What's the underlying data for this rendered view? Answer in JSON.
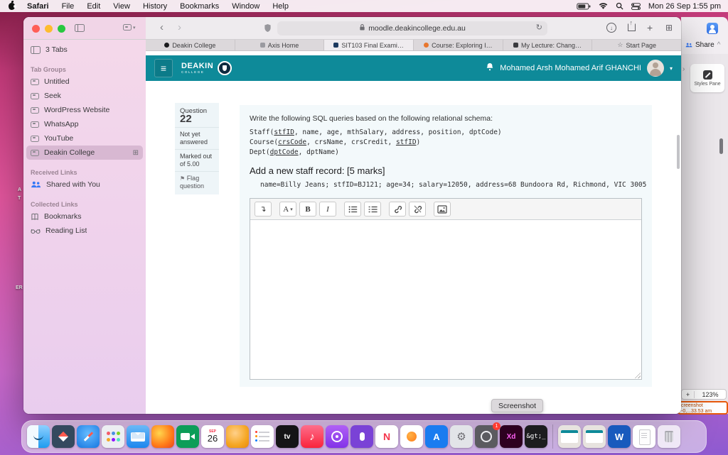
{
  "colors": {
    "accent_teal": "#0e8a99",
    "desktop_pink": "#e0559c",
    "desktop_purple": "#8e5ad0",
    "sidebar_pink": "#f1d5e7",
    "notif_orange": "#e8590c"
  },
  "menubar": {
    "items": [
      "Safari",
      "File",
      "Edit",
      "View",
      "History",
      "Bookmarks",
      "Window",
      "Help"
    ],
    "clock": "Mon 26 Sep 1:55 pm"
  },
  "safari": {
    "url": "moodle.deakincollege.edu.au",
    "tabs": [
      {
        "label": "Deakin College"
      },
      {
        "label": "Axis Home"
      },
      {
        "label": "SIT103 Final Exami…"
      },
      {
        "label": "Course: Exploring I…"
      },
      {
        "label": "My Lecture: Chang…"
      },
      {
        "label": "Start Page"
      }
    ]
  },
  "sidebar": {
    "tabs_header": "3 Tabs",
    "sections": {
      "tab_groups": "Tab Groups",
      "received": "Received Links",
      "collected": "Collected Links"
    },
    "tab_groups": [
      {
        "label": "Untitled"
      },
      {
        "label": "Seek"
      },
      {
        "label": "WordPress Website"
      },
      {
        "label": "WhatsApp"
      },
      {
        "label": "YouTube"
      },
      {
        "label": "Deakin College"
      }
    ],
    "received": [
      {
        "label": "Shared with You"
      }
    ],
    "collected": [
      {
        "label": "Bookmarks"
      },
      {
        "label": "Reading List"
      }
    ]
  },
  "moodle": {
    "logo_top": "DEAKIN",
    "logo_bottom": "COLLEGE",
    "user_name": "Mohamed Arsh Mohamed Arif GHANCHI"
  },
  "question": {
    "label": "Question",
    "number": "22",
    "status_answered": "Not yet answered",
    "status_marks": "Marked out of 5.00",
    "flag_label": "Flag question",
    "prompt": "Write the following SQL queries based on the following relational schema:",
    "schema_line1": {
      "a": "Staff(",
      "key1": "stfID",
      "b": ", name, age, mthSalary, address, position, dptCode)"
    },
    "schema_line2": {
      "a": "Course(",
      "key1": "crsCode",
      "b": ", crsName, crsCredit, ",
      "key2": "stfID",
      "c": ")"
    },
    "schema_line3": {
      "a": "Dept(",
      "key1": "dptCode",
      "b": ", dptName)"
    },
    "task": "Add a new staff record: [5 marks]",
    "record": "name=Billy Jeans; stfID=BJ121; age=34; salary=12050, address=68 Bundoora Rd, Richmond, VIC 3005"
  },
  "editor": {
    "font_label": "A",
    "bold_label": "B",
    "italic_label": "I"
  },
  "tooltip": {
    "screenshot": "Screenshot"
  },
  "right_panels": {
    "share": "Share",
    "styles_pane": "Styles Pane",
    "zoom_plus": "+",
    "zoom": "123%",
    "shot_line1": "creenshot",
    "shot_line2": "-0,...33.53 am"
  },
  "desktop_labels": {
    "a": "A",
    "t": "T",
    "er": "ER"
  },
  "dock": {
    "calendar_month": "SEP",
    "calendar_day": "26",
    "tv": "tv",
    "news": "N",
    "appstore": "A",
    "word": "W",
    "xd": "Xd",
    "terminal": "&gt;_",
    "camera_badge": "1"
  },
  "icons": {
    "star": "☆",
    "flag": "⚑",
    "grid": "⊞",
    "caret_down": "▾",
    "chevron_left": "‹",
    "chevron_right": "›",
    "chevron_up": "^",
    "panel_arrow": "›",
    "reload": "↻",
    "plus": "+",
    "hamburger": "≡",
    "share_up": "↑",
    "download": "↓",
    "return_arrow": "↴",
    "music_note": "♪",
    "gear": "⚙"
  }
}
